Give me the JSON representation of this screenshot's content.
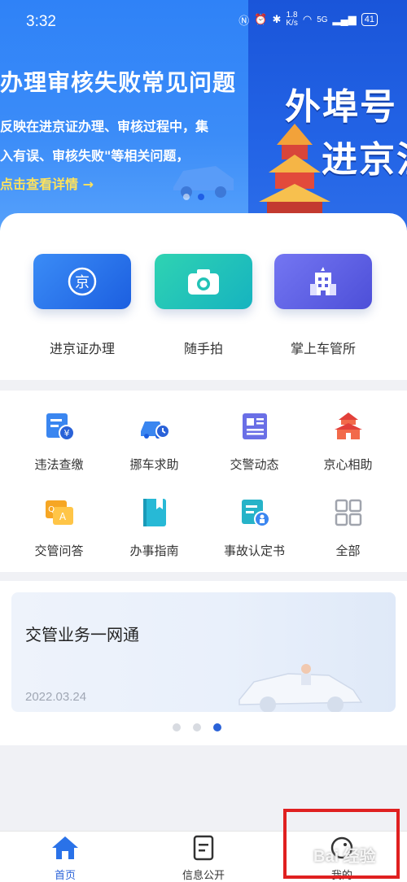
{
  "status_bar": {
    "time": "3:32",
    "network_speed": "1.8",
    "network_unit": "K/s",
    "signal": "5G",
    "battery": "41"
  },
  "banner": {
    "title": "办理审核失败常见问题",
    "line1": "反映在进京证办理、审核过程中，集",
    "line2": "入有误、审核失败\"等相关问题，",
    "link": "点击查看详情 →",
    "big_line1": "外埠号",
    "big_line2": "进京注"
  },
  "main_services": [
    {
      "label": "进京证办理",
      "icon": "jing-badge-icon",
      "color": "#2a72e8"
    },
    {
      "label": "随手拍",
      "icon": "camera-icon",
      "color": "#24c3b4"
    },
    {
      "label": "掌上车管所",
      "icon": "building-icon",
      "color": "#5b5fe0"
    }
  ],
  "grid_services": [
    {
      "label": "违法查缴",
      "icon": "fine-payment-icon"
    },
    {
      "label": "挪车求助",
      "icon": "car-clock-icon"
    },
    {
      "label": "交警动态",
      "icon": "news-icon"
    },
    {
      "label": "京心相助",
      "icon": "tiananmen-icon"
    },
    {
      "label": "交管问答",
      "icon": "qa-icon"
    },
    {
      "label": "办事指南",
      "icon": "guide-book-icon"
    },
    {
      "label": "事故认定书",
      "icon": "accident-doc-icon"
    },
    {
      "label": "全部",
      "icon": "all-grid-icon"
    }
  ],
  "news": {
    "title": "交管业务一网通",
    "date": "2022.03.24"
  },
  "bottom_nav": [
    {
      "label": "首页",
      "icon": "home-icon",
      "active": true
    },
    {
      "label": "信息公开",
      "icon": "document-icon",
      "active": false
    },
    {
      "label": "我的",
      "icon": "profile-icon",
      "active": false
    }
  ],
  "watermark": "Bai 经验",
  "colors": {
    "accent": "#2a62d8",
    "banner": "#2f82f7",
    "highlight": "#e02020"
  }
}
